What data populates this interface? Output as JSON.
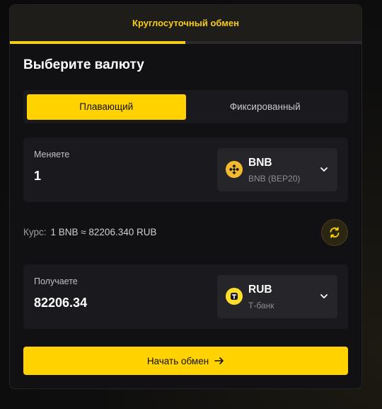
{
  "header": {
    "tab_label": "Круглосуточный обмен"
  },
  "title": "Выберите валюту",
  "rate_type": {
    "options": [
      "Плавающий",
      "Фиксированный"
    ],
    "selected": "Плавающий"
  },
  "send": {
    "label": "Меняете",
    "amount": "1",
    "currency": {
      "code": "BNB",
      "network": "BNB (BEP20)",
      "icon": "bnb-coin-icon",
      "color": "#f3ba2f"
    }
  },
  "rate": {
    "label": "Курс:",
    "value": "1 BNB ≈ 82206.340 RUB"
  },
  "receive": {
    "label": "Получаете",
    "amount": "82206.34",
    "currency": {
      "code": "RUB",
      "network": "Т-банк",
      "icon": "tbank-icon",
      "color": "#ffdd2d"
    }
  },
  "cta": {
    "label": "Начать обмен"
  },
  "colors": {
    "accent": "#ffd200",
    "card": "#111114",
    "panel": "#1a1a1e"
  }
}
